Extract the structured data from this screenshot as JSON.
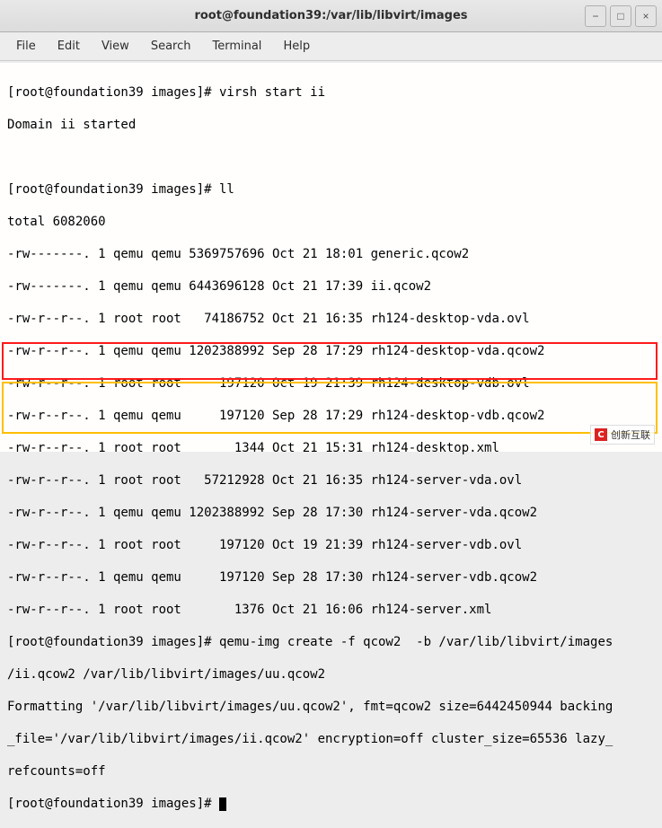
{
  "window": {
    "title": "root@foundation39:/var/lib/libvirt/images",
    "controls": {
      "min": "−",
      "max": "□",
      "close": "×"
    }
  },
  "menu": {
    "file": "File",
    "edit": "Edit",
    "view": "View",
    "search": "Search",
    "terminal": "Terminal",
    "help": "Help"
  },
  "term": {
    "l01": "[root@foundation39 images]# virsh start ii",
    "l02": "Domain ii started",
    "l03": "",
    "l04": "[root@foundation39 images]# ll",
    "l05": "total 6082060",
    "l06": "-rw-------. 1 qemu qemu 5369757696 Oct 21 18:01 generic.qcow2",
    "l07": "-rw-------. 1 qemu qemu 6443696128 Oct 21 17:39 ii.qcow2",
    "l08": "-rw-r--r--. 1 root root   74186752 Oct 21 16:35 rh124-desktop-vda.ovl",
    "l09": "-rw-r--r--. 1 qemu qemu 1202388992 Sep 28 17:29 rh124-desktop-vda.qcow2",
    "l10": "-rw-r--r--. 1 root root     197120 Oct 19 21:39 rh124-desktop-vdb.ovl",
    "l11": "-rw-r--r--. 1 qemu qemu     197120 Sep 28 17:29 rh124-desktop-vdb.qcow2",
    "l12": "-rw-r--r--. 1 root root       1344 Oct 21 15:31 rh124-desktop.xml",
    "l13": "-rw-r--r--. 1 root root   57212928 Oct 21 16:35 rh124-server-vda.ovl",
    "l14": "-rw-r--r--. 1 qemu qemu 1202388992 Sep 28 17:30 rh124-server-vda.qcow2",
    "l15": "-rw-r--r--. 1 root root     197120 Oct 19 21:39 rh124-server-vdb.ovl",
    "l16": "-rw-r--r--. 1 qemu qemu     197120 Sep 28 17:30 rh124-server-vdb.qcow2",
    "l17": "-rw-r--r--. 1 root root       1376 Oct 21 16:06 rh124-server.xml",
    "l18": "[root@foundation39 images]# qemu-img create -f qcow2  -b /var/lib/libvirt/images",
    "l19": "/ii.qcow2 /var/lib/libvirt/images/uu.qcow2",
    "l20": "Formatting '/var/lib/libvirt/images/uu.qcow2', fmt=qcow2 size=6442450944 backing",
    "l21": "_file='/var/lib/libvirt/images/ii.qcow2' encryption=off cluster_size=65536 lazy_",
    "l22": "refcounts=off",
    "l23": "[root@foundation39 images]# "
  },
  "watermark": {
    "badge": "C",
    "text": "创新互联"
  }
}
